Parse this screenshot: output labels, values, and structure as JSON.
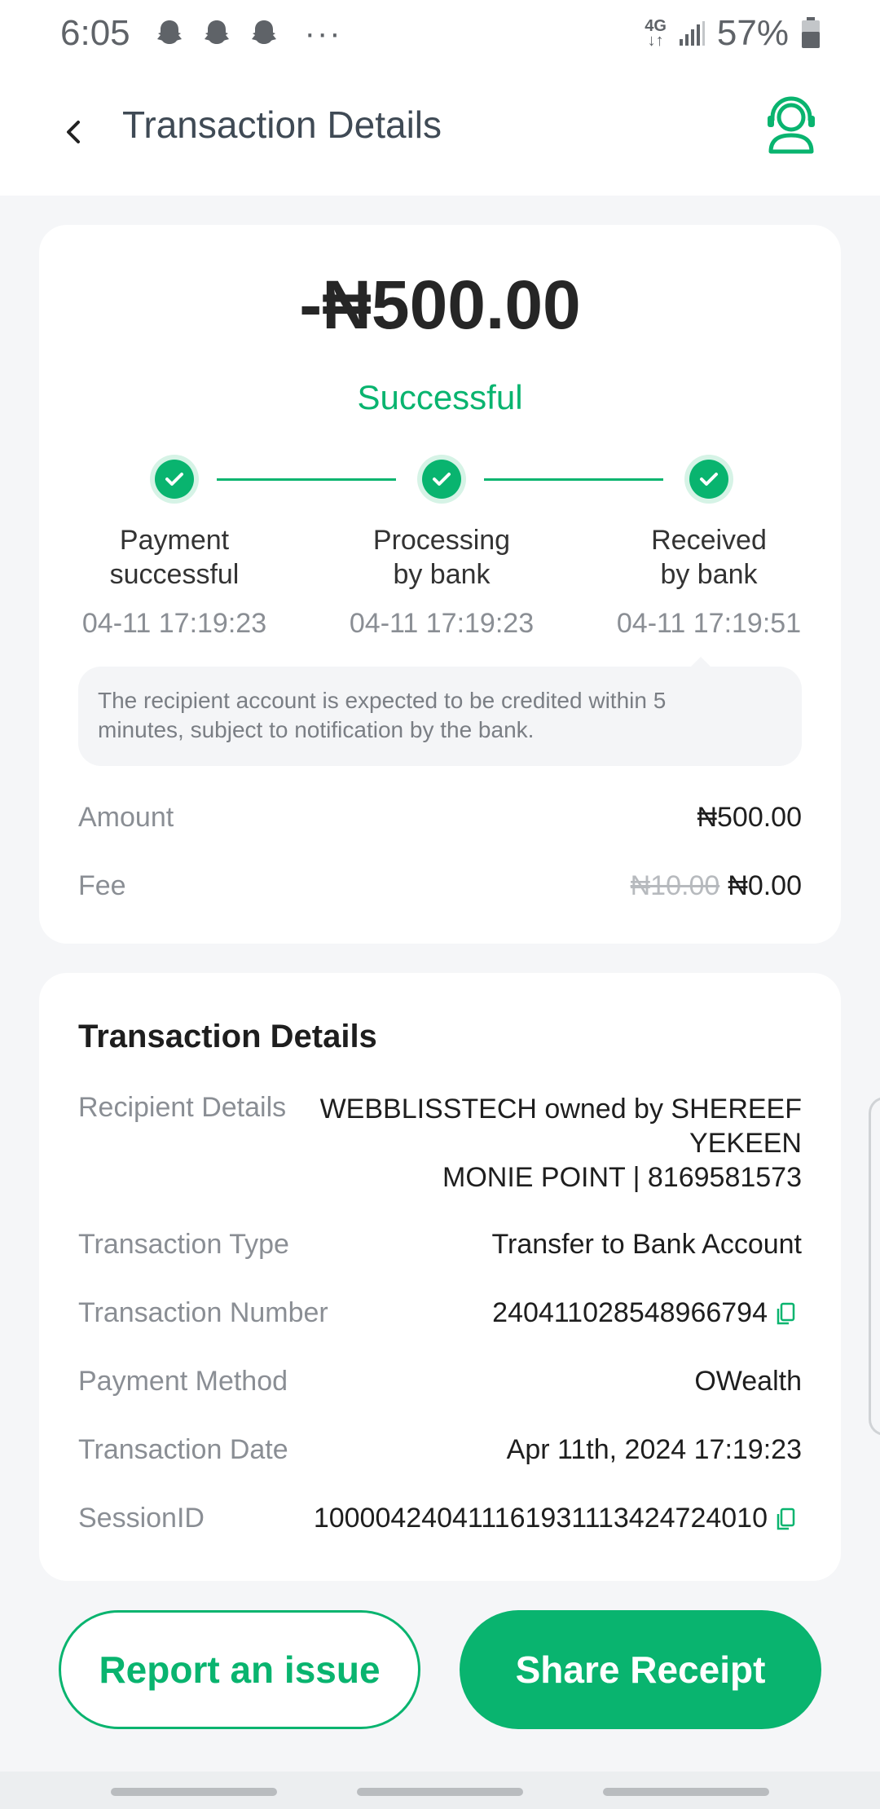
{
  "status_bar": {
    "time": "6:05",
    "more": "···",
    "network_top": "4G",
    "network_bottom": "↓↑",
    "battery": "57%"
  },
  "header": {
    "title": "Transaction Details",
    "back_icon": "chevron-left-icon",
    "support_icon": "headset-support-icon"
  },
  "summary": {
    "amount": "-₦500.00",
    "status": "Successful",
    "steps": [
      {
        "label_line1": "Payment",
        "label_line2": "successful",
        "time": "04-11 17:19:23"
      },
      {
        "label_line1": "Processing",
        "label_line2": "by bank",
        "time": "04-11 17:19:23"
      },
      {
        "label_line1": "Received",
        "label_line2": "by bank",
        "time": "04-11 17:19:51"
      }
    ],
    "notice_line1": "The recipient account is expected to be credited within 5",
    "notice_line2": "minutes, subject to notification by the bank.",
    "amount_label": "Amount",
    "amount_value": "₦500.00",
    "fee_label": "Fee",
    "fee_old": "₦10.00",
    "fee_new": "₦0.00"
  },
  "details": {
    "title": "Transaction Details",
    "recipient_label": "Recipient Details",
    "recipient_line1": "WEBBLISSTECH owned by SHEREEF",
    "recipient_line2": "YEKEEN",
    "recipient_line3": "MONIE POINT | 8169581573",
    "type_label": "Transaction Type",
    "type_value": "Transfer to Bank Account",
    "number_label": "Transaction Number",
    "number_value": "240411028548966794",
    "method_label": "Payment Method",
    "method_value": "OWealth",
    "date_label": "Transaction Date",
    "date_value": "Apr 11th, 2024 17:19:23",
    "session_label": "SessionID",
    "session_value": "100004240411161931113424724010"
  },
  "actions": {
    "report": "Report an issue",
    "share": "Share Receipt"
  },
  "colors": {
    "accent": "#09b46f",
    "text_primary": "#1e1e1e",
    "text_secondary": "#8a8e94",
    "background": "#f5f6f8"
  }
}
